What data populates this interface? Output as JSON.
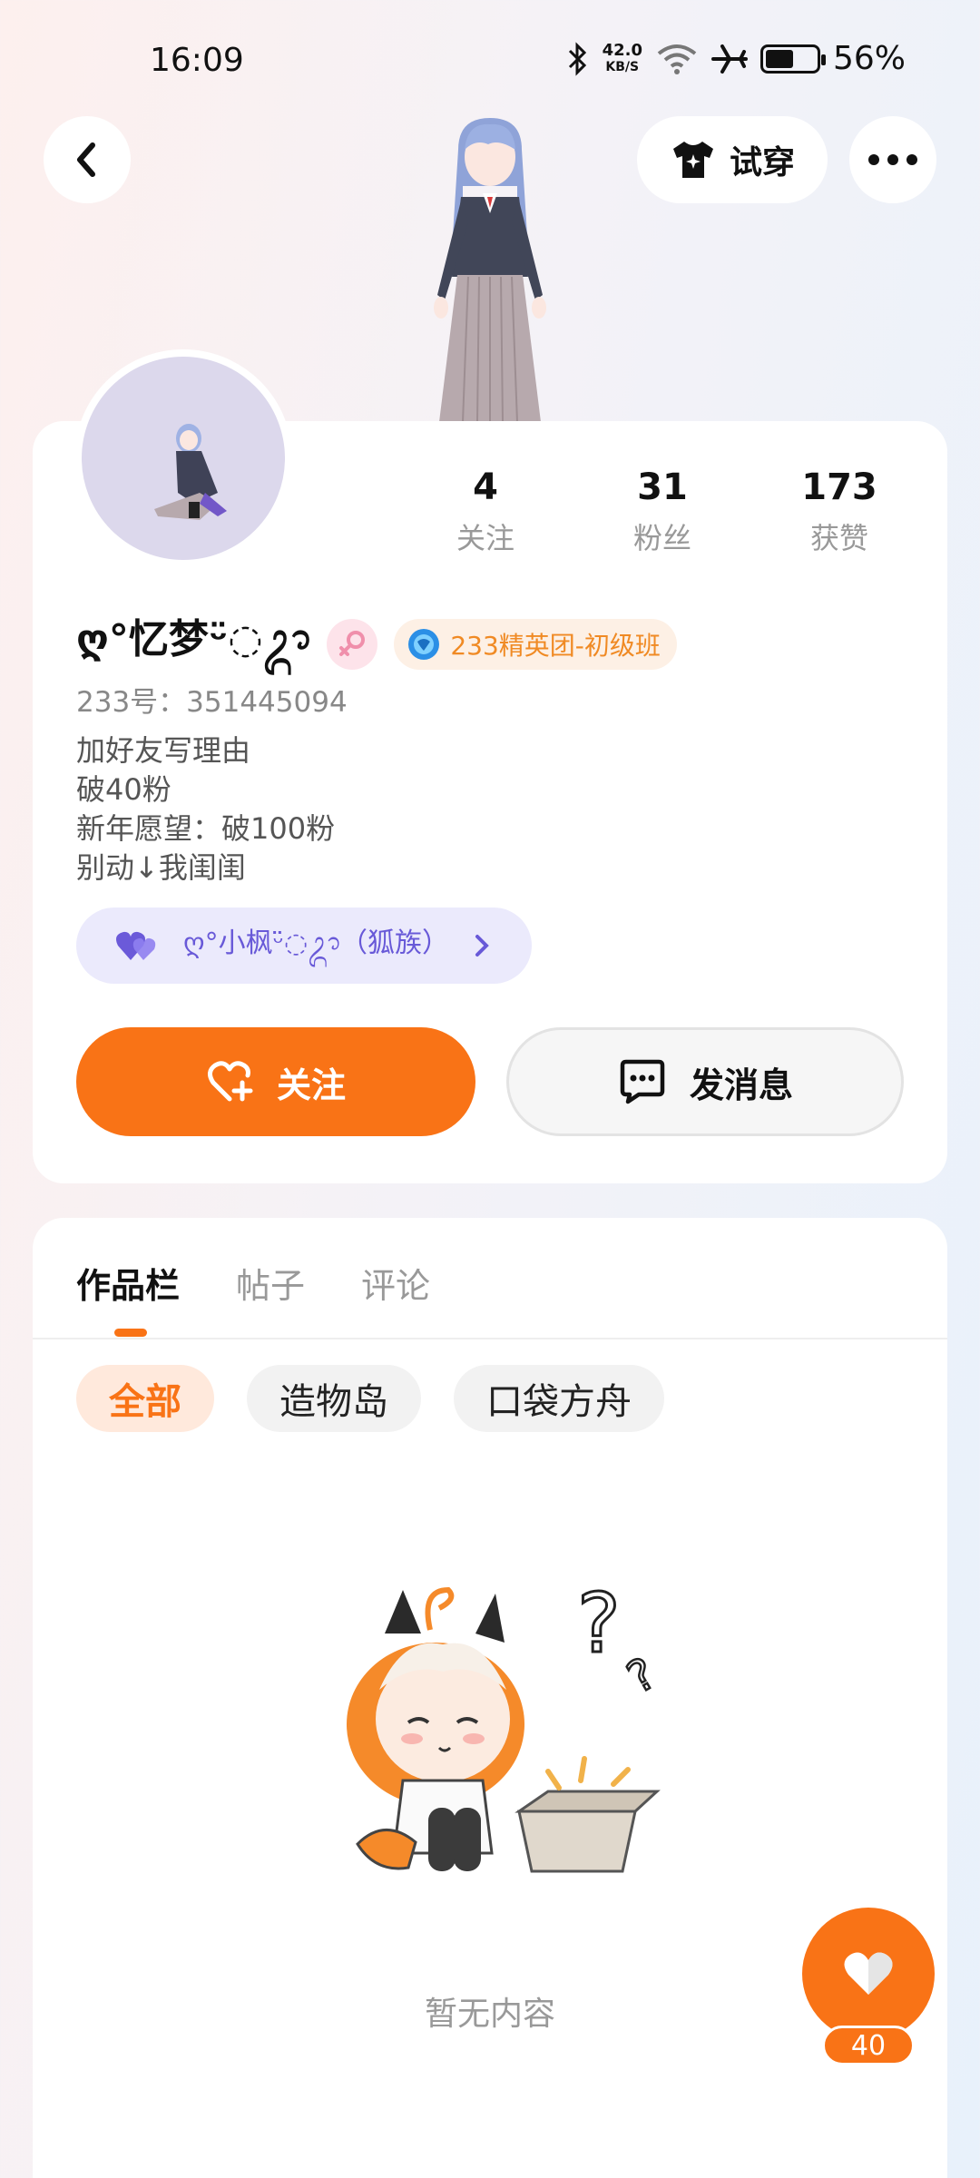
{
  "status_bar": {
    "time": "16:09",
    "net_speed_value": "42.0",
    "net_speed_unit": "KB/S",
    "battery_percent": "56%",
    "battery_level": 0.56,
    "icons": [
      "bluetooth-icon",
      "wifi-icon",
      "airplane-mode-icon",
      "battery-icon"
    ]
  },
  "header": {
    "try_on_label": "试穿"
  },
  "profile": {
    "stats": [
      {
        "value": "4",
        "label": "关注"
      },
      {
        "value": "31",
        "label": "粉丝"
      },
      {
        "value": "173",
        "label": "获赞"
      }
    ],
    "nickname": "ღ°忆梦ᵕ̈◌ᬊ",
    "elite_badge": "233精英团-初级班",
    "uid": "233号：351445094",
    "bio": [
      "加好友写理由",
      "破40粉",
      "新年愿望：破100粉",
      "别动↓我闺闺"
    ],
    "family_chip": "ღ°小枫ᵕ̈◌ᬊ（狐族）",
    "follow_label": "关注",
    "message_label": "发消息"
  },
  "works": {
    "tabs": [
      {
        "label": "作品栏",
        "active": true
      },
      {
        "label": "帖子",
        "active": false
      },
      {
        "label": "评论",
        "active": false
      }
    ],
    "chips": [
      {
        "label": "全部",
        "active": true
      },
      {
        "label": "造物岛",
        "active": false
      },
      {
        "label": "口袋方舟",
        "active": false
      }
    ],
    "empty_text": "暂无内容"
  },
  "like_fab": {
    "count": "40"
  },
  "colors": {
    "accent": "#f97316",
    "family": "#6859d8",
    "elite": "#f08a24"
  }
}
